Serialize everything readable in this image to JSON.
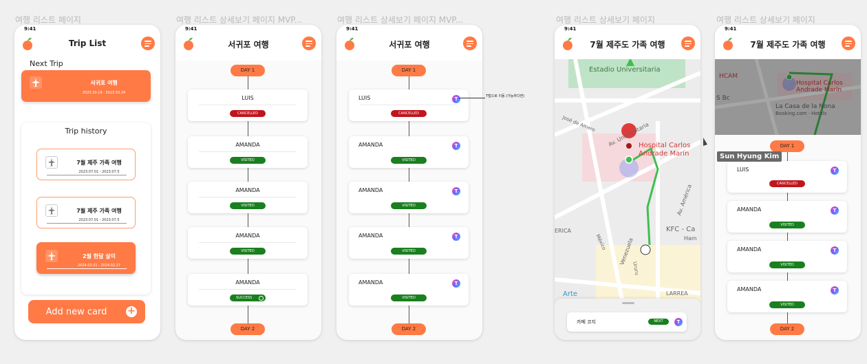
{
  "frames": [
    {
      "label": "여행 리스트 페이지"
    },
    {
      "label": "여행 리스트 상세보기 페이지 MVP..."
    },
    {
      "label": "여행 리스트 상세보기 페이지 MVP..."
    },
    {
      "label": "여행 리스트 상세보기 페이지"
    },
    {
      "label": "여행 리스트 상세보기 페이지"
    }
  ],
  "status_time": "9:41",
  "trip_list": {
    "title": "Trip List",
    "next_trip_label": "Next Trip",
    "next_trip": {
      "title": "서귀포 여행",
      "dates": "2023.10.19 - 2023.10.24"
    },
    "history_title": "Trip history",
    "history": [
      {
        "title": "7월 제주 가족 여행",
        "dates": "2023.07.01 - 2023.07.5"
      },
      {
        "title": "7월 제주 가족 여행",
        "dates": "2023.07.01 - 2023.07.5"
      },
      {
        "title": "2월 한달 살이",
        "dates": "2024.02.01 - 2024.02.27"
      }
    ],
    "add_card_label": "Add new card"
  },
  "detail_mvp_a": {
    "title": "서귀포 여행",
    "day1": "DAY 1",
    "day2": "DAY 2",
    "places": [
      {
        "name": "LUIS",
        "status": "CANCELLED"
      },
      {
        "name": "AMANDA",
        "status": "VISITED"
      },
      {
        "name": "AMANDA",
        "status": "VISITED"
      },
      {
        "name": "AMANDA",
        "status": "VISITED"
      },
      {
        "name": "AMANDA",
        "status": "SUCCESS"
      }
    ]
  },
  "detail_mvp_b": {
    "title": "서귀포 여행",
    "day1": "DAY 1",
    "day2": "DAY 2",
    "annotation": "T맵으로 이동 (가능하다면)",
    "places": [
      {
        "name": "LUIS",
        "status": "CANCELLED"
      },
      {
        "name": "AMANDA",
        "status": "VISITED"
      },
      {
        "name": "AMANDA",
        "status": "VISITED"
      },
      {
        "name": "AMANDA",
        "status": "VISITED"
      },
      {
        "name": "AMANDA",
        "status": "VISITED"
      }
    ]
  },
  "detail_map": {
    "title": "7월 제주도 가족 여행",
    "map_labels": [
      "Estadio Universitaria",
      "Hospital Carlos Andrade Marín",
      "Av. Universitaria",
      "José de Amero",
      "KFC - Ca",
      "Ham",
      "LARREA",
      "Arte",
      "ERICA",
      "Av. América",
      "Venezuela",
      "México",
      "Ururu"
    ],
    "current_place": "카페 코지",
    "current_status": "NEXT"
  },
  "detail_full": {
    "title": "7월 제주도 가족 여행",
    "map_labels": [
      "HCAM",
      "Hospital Carlos Andrade Marín",
      "S Bc",
      "La Casa de la Nona",
      "Booking.com · Hotels"
    ],
    "day1": "DAY 1",
    "day2": "DAY 2",
    "places": [
      {
        "name": "LUIS",
        "status": "CANCELLED"
      },
      {
        "name": "AMANDA",
        "status": "VISITED"
      },
      {
        "name": "AMANDA",
        "status": "VISITED"
      },
      {
        "name": "AMANDA",
        "status": "VISITED"
      }
    ]
  },
  "cursor_tooltip": "Sun Hyung Kim",
  "colors": {
    "accent": "#ff7a45",
    "cancelled": "#c0151d",
    "visited": "#1a7f1f"
  }
}
